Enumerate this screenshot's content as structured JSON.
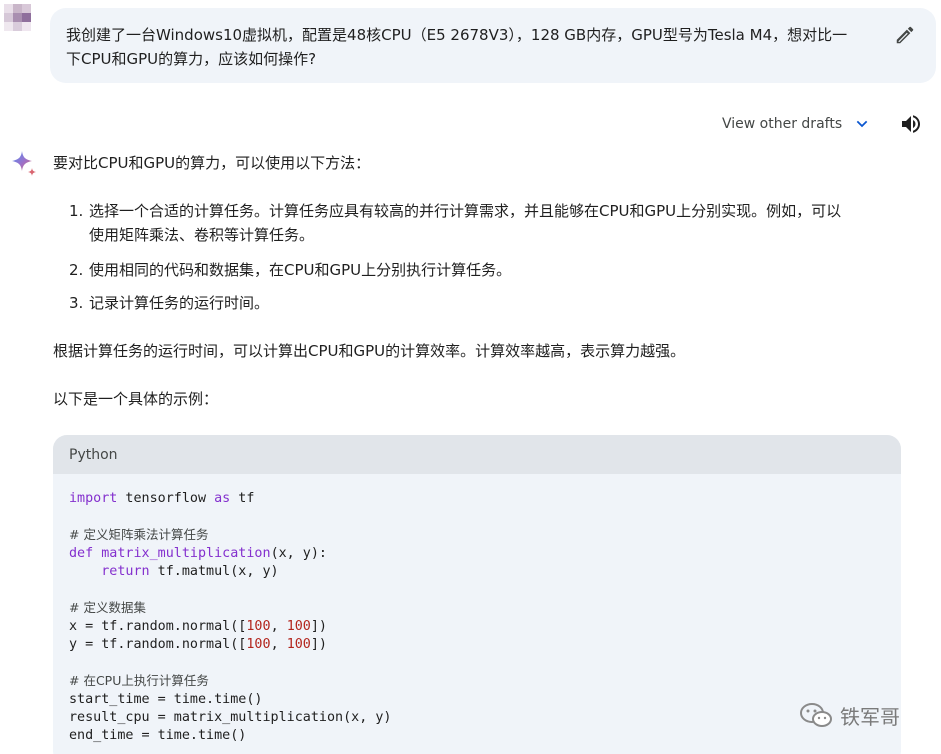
{
  "user_prompt": {
    "line1": "我创建了一台Windows10虚拟机，配置是48核CPU（E5 2678V3），128 GB内存，GPU型号为Tesla M4，想对比一",
    "line2": "下CPU和GPU的算力，应该如何操作?"
  },
  "toolbar": {
    "view_drafts_label": "View other drafts"
  },
  "response": {
    "intro": "要对比CPU和GPU的算力，可以使用以下方法：",
    "steps": [
      {
        "num": "1.",
        "line1": "选择一个合适的计算任务。计算任务应具有较高的并行计算需求，并且能够在CPU和GPU上分别实现。例如，可以",
        "line2": "使用矩阵乘法、卷积等计算任务。"
      },
      {
        "num": "2.",
        "line1": "使用相同的代码和数据集，在CPU和GPU上分别执行计算任务。"
      },
      {
        "num": "3.",
        "line1": "记录计算任务的运行时间。"
      }
    ],
    "para2": "根据计算任务的运行时间，可以计算出CPU和GPU的计算效率。计算效率越高，表示算力越强。",
    "para3": "以下是一个具体的示例："
  },
  "code": {
    "language": "Python",
    "import_kw": "import",
    "import_mod": " tensorflow ",
    "as_kw": "as",
    "import_alias": " tf",
    "c1": "# 定义矩阵乘法计算任务",
    "def_kw": "def",
    "def_fn": " matrix_multiplication",
    "def_args": "(x, y):",
    "ret_indent": "    ",
    "ret_kw": "return",
    "ret_expr": " tf.matmul(x, y)",
    "c2": "# 定义数据集",
    "x_pre": "x = tf.random.normal([",
    "y_pre": "y = tf.random.normal([",
    "n100": "100",
    "sep": ", ",
    "close": "])",
    "c3": "# 在CPU上执行计算任务",
    "l_start": "start_time = time.time()",
    "l_result": "result_cpu = matrix_multiplication(x, y)",
    "l_end": "end_time = time.time()"
  },
  "watermark": {
    "text": "铁军哥"
  }
}
